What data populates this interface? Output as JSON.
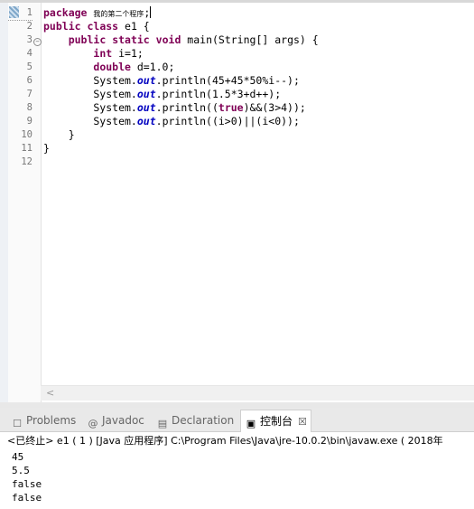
{
  "editor": {
    "line_numbers": [
      "1",
      "2",
      "3",
      "4",
      "5",
      "6",
      "7",
      "8",
      "9",
      "10",
      "11",
      "12"
    ],
    "lines": [
      [
        {
          "t": "package",
          "c": "kw"
        },
        {
          "t": " "
        },
        {
          "t": "我的第二个程序",
          "c": "cjk"
        },
        {
          "t": ";"
        }
      ],
      [
        {
          "t": "public",
          "c": "kw"
        },
        {
          "t": " "
        },
        {
          "t": "class",
          "c": "kw"
        },
        {
          "t": " e1 {"
        }
      ],
      [
        {
          "t": "    "
        },
        {
          "t": "public",
          "c": "kw"
        },
        {
          "t": " "
        },
        {
          "t": "static",
          "c": "kw"
        },
        {
          "t": " "
        },
        {
          "t": "void",
          "c": "kw"
        },
        {
          "t": " main(String[] args) {"
        }
      ],
      [
        {
          "t": "        "
        },
        {
          "t": "int",
          "c": "kw"
        },
        {
          "t": " i=1;"
        }
      ],
      [
        {
          "t": "        "
        },
        {
          "t": "double",
          "c": "kw"
        },
        {
          "t": " d=1.0;"
        }
      ],
      [
        {
          "t": "        System."
        },
        {
          "t": "out",
          "c": "st"
        },
        {
          "t": ".println(45+45*50%i--);"
        }
      ],
      [
        {
          "t": "        System."
        },
        {
          "t": "out",
          "c": "st"
        },
        {
          "t": ".println(1.5*3+d++);"
        }
      ],
      [
        {
          "t": "        System."
        },
        {
          "t": "out",
          "c": "st"
        },
        {
          "t": ".println(("
        },
        {
          "t": "true",
          "c": "kw"
        },
        {
          "t": ")&&(3>4));"
        }
      ],
      [
        {
          "t": "        System."
        },
        {
          "t": "out",
          "c": "st"
        },
        {
          "t": ".println((i>0)||(i<0));"
        }
      ],
      [
        {
          "t": "    }"
        }
      ],
      [
        {
          "t": "}"
        }
      ],
      [
        {
          "t": ""
        }
      ]
    ],
    "fold_icon": "collapse-fold-icon"
  },
  "hscroll": {
    "left_arrow": "<"
  },
  "tabs": [
    {
      "label": "Problems",
      "icon": "problems-icon",
      "glyph": "☐",
      "active": false
    },
    {
      "label": "Javadoc",
      "icon": "javadoc-icon",
      "glyph": "@",
      "active": false
    },
    {
      "label": "Declaration",
      "icon": "declaration-icon",
      "glyph": "▤",
      "active": false
    },
    {
      "label": "控制台",
      "icon": "console-icon",
      "glyph": "▣",
      "active": true,
      "close": "☒"
    }
  ],
  "console": {
    "header": "<已终止> e1 ( 1 )  [Java 应用程序] C:\\Program Files\\Java\\jre-10.0.2\\bin\\javaw.exe ( 2018年",
    "output": [
      "45",
      "5.5",
      "false",
      "false"
    ]
  },
  "colors": {
    "keyword": "#7f0055",
    "static_field": "#0000c0",
    "line_number": "#787878"
  }
}
